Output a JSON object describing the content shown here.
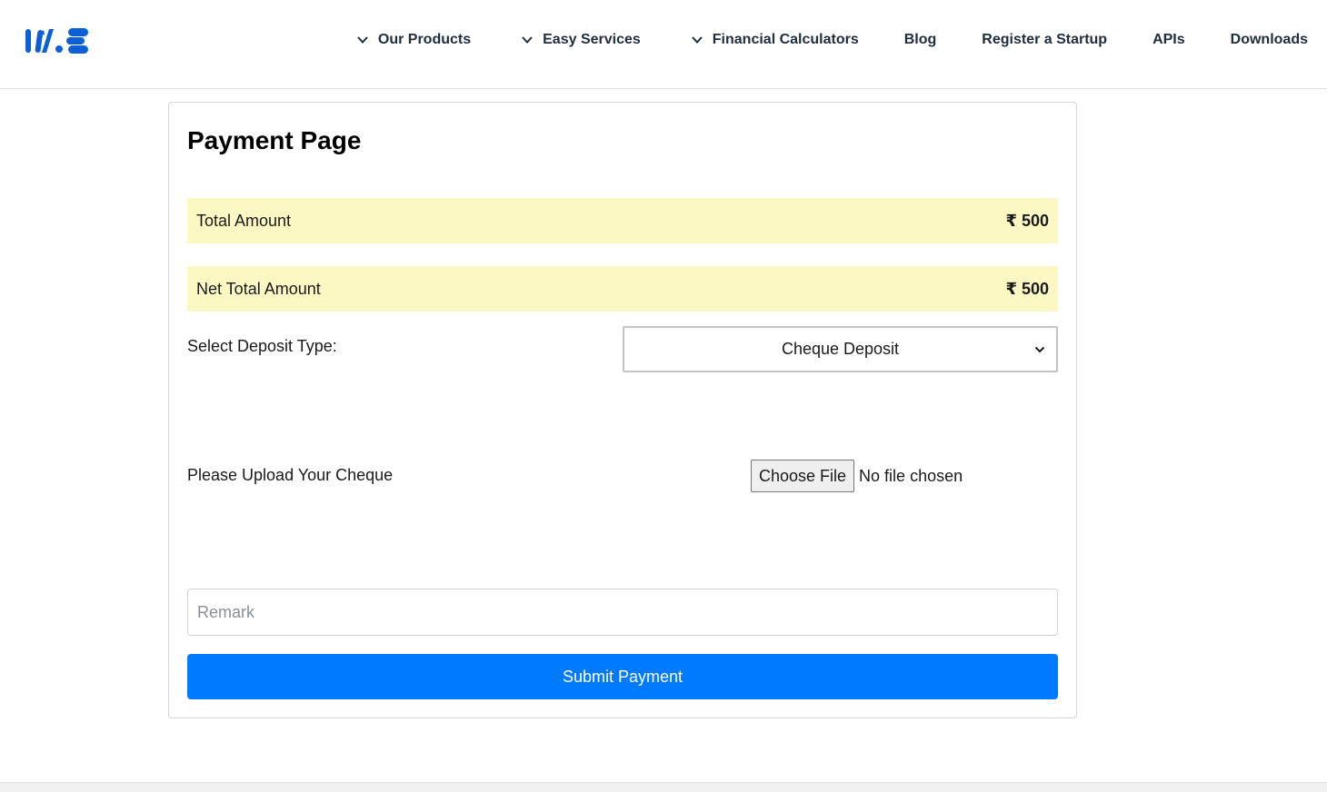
{
  "header": {
    "logo_icon": "brand-logo-icon",
    "nav": [
      {
        "label": "Our Products",
        "has_dropdown": true
      },
      {
        "label": "Easy Services",
        "has_dropdown": true
      },
      {
        "label": "Financial Calculators",
        "has_dropdown": true
      },
      {
        "label": "Blog",
        "has_dropdown": false
      },
      {
        "label": "Register a Startup",
        "has_dropdown": false
      },
      {
        "label": "APIs",
        "has_dropdown": false
      },
      {
        "label": "Downloads",
        "has_dropdown": false
      }
    ]
  },
  "payment": {
    "title": "Payment Page",
    "total_amount_label": "Total Amount",
    "total_amount_value": "₹ 500",
    "net_total_label": "Net Total Amount",
    "net_total_value": "₹ 500",
    "deposit_type_label": "Select Deposit Type:",
    "deposit_type_selected": "Cheque Deposit",
    "upload_label": "Please Upload Your Cheque",
    "choose_file_label": "Choose File",
    "file_status": "No file chosen",
    "remark_placeholder": "Remark",
    "remark_value": "",
    "submit_label": "Submit Payment"
  },
  "colors": {
    "brand_blue": "#0d5fd6",
    "highlight_yellow": "#fcf8c3",
    "submit_blue": "#007bff"
  }
}
